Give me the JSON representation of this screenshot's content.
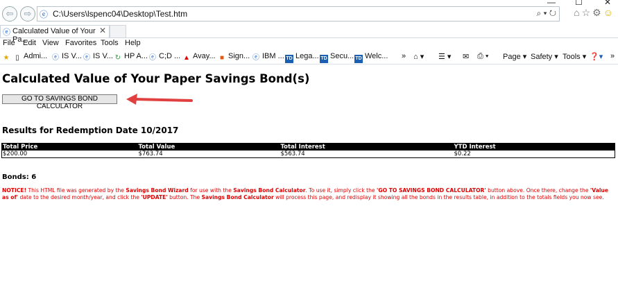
{
  "window": {
    "minimize": "—",
    "maximize": "☐",
    "close": "✕"
  },
  "browser": {
    "url": "C:\\Users\\lspenc04\\Desktop\\Test.htm",
    "tab_title": "Calculated Value of Your Pa...",
    "menu": [
      "File",
      "Edit",
      "View",
      "Favorites",
      "Tools",
      "Help"
    ],
    "favorites": [
      "Admi...",
      "IS V...",
      "IS V...",
      "HP A...",
      "C;D ...",
      "Avay...",
      "Sign...",
      "IBM ...",
      "Lega...",
      "Secu...",
      "Welc..."
    ],
    "commands": {
      "page": "Page",
      "safety": "Safety",
      "tools": "Tools"
    }
  },
  "page": {
    "title": "Calculated Value of Your Paper Savings Bond(s)",
    "calc_button": "GO TO SAVINGS BOND CALCULATOR",
    "results_heading": "Results for Redemption Date 10/2017",
    "table": {
      "headers": [
        "Total Price",
        "Total Value",
        "Total Interest",
        "YTD Interest"
      ],
      "row": [
        "$200.00",
        "$763.74",
        "$563.74",
        "$0.22"
      ]
    },
    "bonds": "Bonds: 6",
    "notice": {
      "p1": "NOTICE!",
      "p2": " This HTML file was generated by the ",
      "p3": "Savings Bond Wizard",
      "p4": " for use with the ",
      "p5": "Savings Bond Calculator",
      "p6": ". To use it, simply click the ",
      "p7": "'GO TO SAVINGS BOND CALCULATOR'",
      "p8": " button above. Once there, change the ",
      "p9": "'Value as of'",
      "p10": " date to the desired month/year, and click the ",
      "p11": "'UPDATE'",
      "p12": " button. The ",
      "p13": "Savings Bond Calculator",
      "p14": " will process this page, and redisplay it showing all the bonds in the results table, in addition to the totals fields you now see."
    }
  },
  "colors": {
    "notice": "#e00000",
    "arrow": "#e04040",
    "header_bg": "#000000"
  }
}
